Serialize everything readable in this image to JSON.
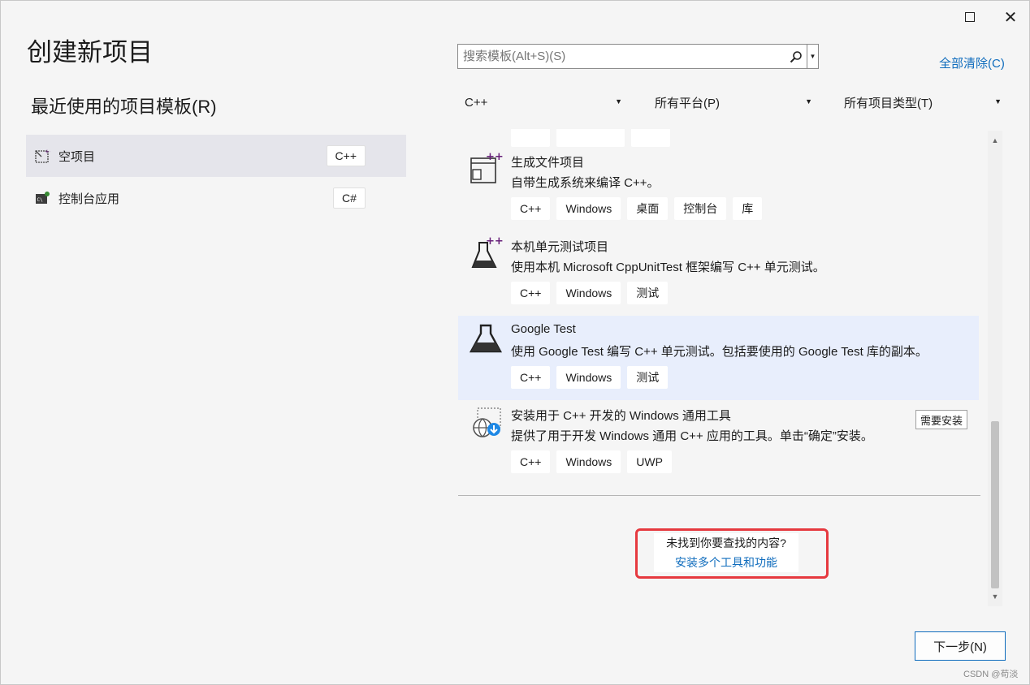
{
  "window": {
    "title": "创建新项目",
    "maximize_icon": "maximize-icon",
    "close_icon": "close-icon"
  },
  "recent": {
    "heading": "最近使用的项目模板(R)",
    "items": [
      {
        "label": "空项目",
        "badge": "C++",
        "icon": "empty-project-icon",
        "selected": true
      },
      {
        "label": "控制台应用",
        "badge": "C#",
        "icon": "console-app-icon",
        "selected": false
      }
    ]
  },
  "search": {
    "placeholder": "搜索模板(Alt+S)(S)",
    "icon": "search-icon",
    "clear_all": "全部清除(C)"
  },
  "filters": {
    "language": "C++",
    "platform": "所有平台(P)",
    "project_type": "所有项目类型(T)"
  },
  "templates": [
    {
      "name": "生成文件项目",
      "desc": "自带生成系统来编译 C++。",
      "tags": [
        "C++",
        "Windows",
        "桌面",
        "控制台",
        "库"
      ],
      "icon": "makefile-project-icon",
      "selected": false
    },
    {
      "name": "本机单元测试项目",
      "desc": "使用本机 Microsoft CppUnitTest 框架编写 C++ 单元测试。",
      "tags": [
        "C++",
        "Windows",
        "测试"
      ],
      "icon": "native-unit-test-icon",
      "selected": false
    },
    {
      "name": "Google Test",
      "desc": "使用 Google Test 编写 C++ 单元测试。包括要使用的 Google Test 库的副本。",
      "tags": [
        "C++",
        "Windows",
        "测试"
      ],
      "icon": "google-test-icon",
      "selected": true
    },
    {
      "name": "安装用于 C++ 开发的 Windows 通用工具",
      "desc": "提供了用于开发 Windows 通用 C++ 应用的工具。单击“确定”安装。",
      "tags": [
        "C++",
        "Windows",
        "UWP"
      ],
      "icon": "install-uwp-tools-icon",
      "badge": "需要安装",
      "selected": false
    }
  ],
  "not_found": {
    "question": "未找到你要查找的内容?",
    "link": "安装多个工具和功能"
  },
  "footer": {
    "next": "下一步(N)",
    "watermark": "CSDN @苟淡"
  },
  "colors": {
    "accent": "#0f6cbd",
    "highlight_box": "#e6393f",
    "selected_template_bg": "#e8eefc"
  }
}
